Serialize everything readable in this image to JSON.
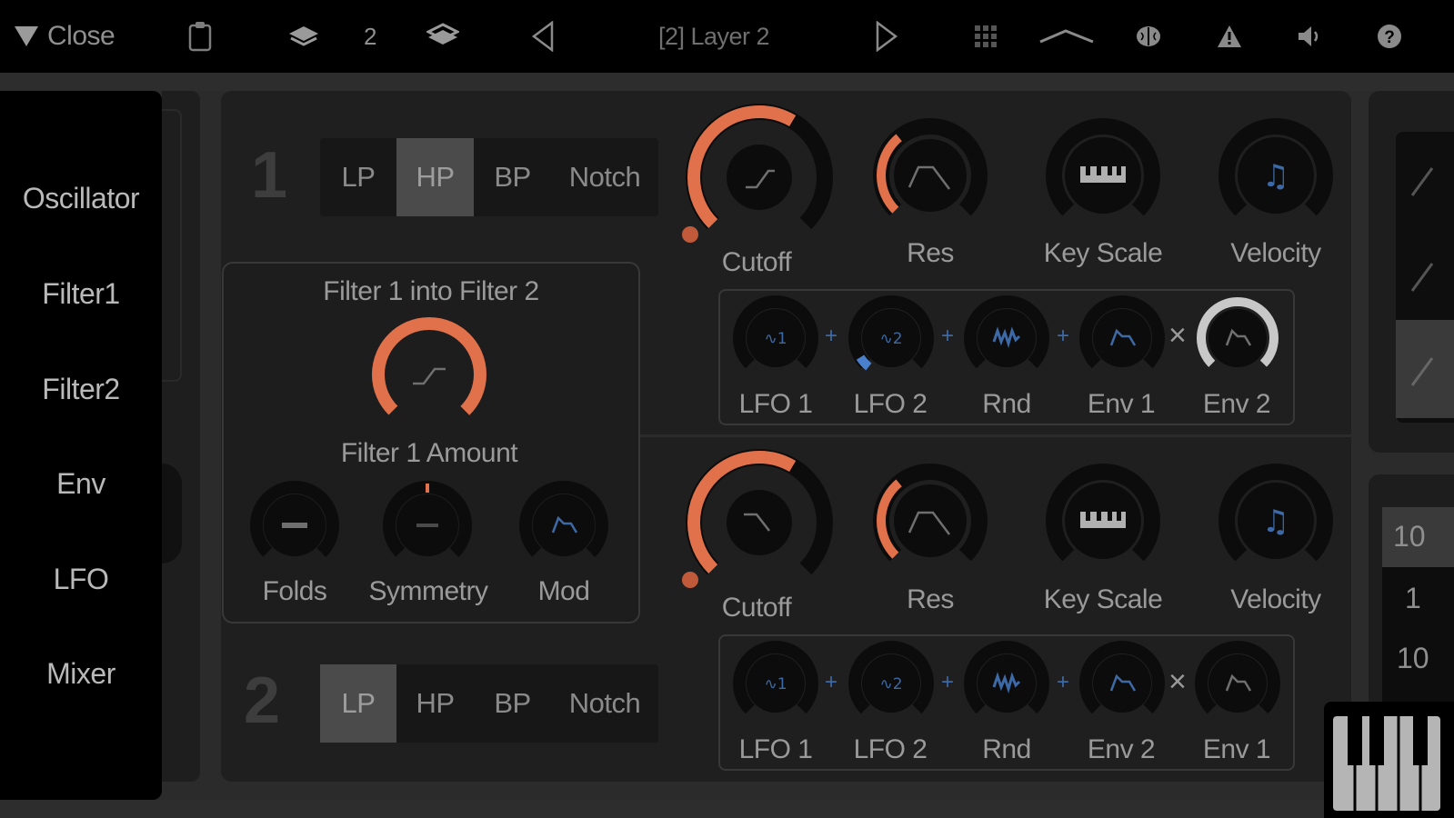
{
  "topbar": {
    "close_label": "Close",
    "layer_number": "2",
    "layer_title": "[2] Layer 2"
  },
  "nav": {
    "items": [
      "Oscillator",
      "Filter1",
      "Filter2",
      "Env",
      "LFO",
      "Mixer"
    ]
  },
  "filter1": {
    "number": "1",
    "modes": [
      "LP",
      "HP",
      "BP",
      "Notch"
    ],
    "active_mode": "HP",
    "knobs": {
      "cutoff": "Cutoff",
      "res": "Res",
      "key_scale": "Key Scale",
      "velocity": "Velocity"
    },
    "mod": [
      "LFO 1",
      "LFO 2",
      "Rnd",
      "Env 1",
      "Env 2"
    ]
  },
  "routing": {
    "title": "Filter 1 into Filter 2",
    "amount_label": "Filter 1 Amount",
    "folds": "Folds",
    "symmetry": "Symmetry",
    "mod": "Mod"
  },
  "filter2": {
    "number": "2",
    "modes": [
      "LP",
      "HP",
      "BP",
      "Notch"
    ],
    "active_mode": "LP",
    "knobs": {
      "cutoff": "Cutoff",
      "res": "Res",
      "key_scale": "Key Scale",
      "velocity": "Velocity"
    },
    "mod": [
      "LFO 1",
      "LFO 2",
      "Rnd",
      "Env 2",
      "Env 1"
    ]
  },
  "right": {
    "values": [
      "10",
      "1",
      "10"
    ]
  },
  "colors": {
    "accent": "#e0714b",
    "mod_blue": "#3d6aa6",
    "knob_dark": "#0c0c0c"
  }
}
